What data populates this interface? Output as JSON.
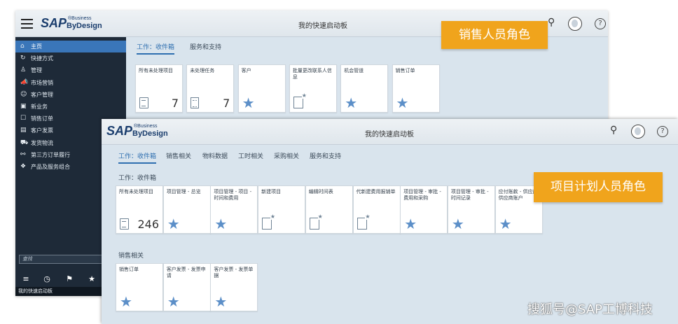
{
  "logo": {
    "sap": "SAP",
    "business": "®Business",
    "bydesign": "ByDesign"
  },
  "win1": {
    "title": "我的快速启动板",
    "tabs": [
      "工作：收件箱",
      "服务和支持"
    ],
    "nav": [
      {
        "icon": "⌂",
        "label": "主页"
      },
      {
        "icon": "↻",
        "label": "快捷方式"
      },
      {
        "icon": "♙",
        "label": "管理"
      },
      {
        "icon": "📣",
        "label": "市场营销"
      },
      {
        "icon": "☺",
        "label": "客户管理"
      },
      {
        "icon": "▣",
        "label": "新业务"
      },
      {
        "icon": "☐",
        "label": "销售订单"
      },
      {
        "icon": "▤",
        "label": "客户发票"
      },
      {
        "icon": "⛟",
        "label": "发货物流"
      },
      {
        "icon": "⚯",
        "label": "第三方订单履行"
      },
      {
        "icon": "❖",
        "label": "产品及服务组合"
      }
    ],
    "search_placeholder": "查找",
    "toolbar": [
      "≡",
      "◷",
      "⚑",
      "★"
    ],
    "status": "我的快速启动板",
    "tiles": [
      {
        "title": "所有未处理项目",
        "count": "7",
        "icon": "document-icon"
      },
      {
        "title": "未处理任务",
        "count": "7",
        "icon": "task-icon"
      },
      {
        "title": "客户",
        "icon": "star-icon"
      },
      {
        "title": "批量更改联系人信息",
        "icon": "new-document-icon"
      },
      {
        "title": "机会管道",
        "icon": "star-icon"
      },
      {
        "title": "销售订单",
        "icon": "star-icon"
      }
    ],
    "banner": "销售人员角色"
  },
  "win2": {
    "title": "我的快速启动板",
    "tabs": [
      "工作：收件箱",
      "销售相关",
      "物料数据",
      "工时相关",
      "采购相关",
      "服务和支持"
    ],
    "section1": "工作：收件箱",
    "tiles1": [
      {
        "title": "所有未处理项目",
        "count": "246",
        "icon": "document-icon"
      },
      {
        "title": "项目管理 - 总览",
        "icon": "star-icon"
      },
      {
        "title": "项目管理 - 项目 - 时间和费用",
        "icon": "star-icon"
      },
      {
        "title": "新建项目",
        "icon": "new-document-icon"
      },
      {
        "title": "编辑时间表",
        "icon": "new-document-icon"
      },
      {
        "title": "代新建费用报销单",
        "icon": "new-document-icon"
      },
      {
        "title": "项目管理 - 审批 - 费用和采购",
        "icon": "star-icon"
      },
      {
        "title": "项目管理 - 审批 - 时间记录",
        "icon": "star-icon"
      },
      {
        "title": "应付账款 - 供应商 - 供应商账户",
        "icon": "star-icon"
      }
    ],
    "section2": "销售相关",
    "tiles2": [
      {
        "title": "销售订单",
        "icon": "star-icon"
      },
      {
        "title": "客户发票 - 发票申请",
        "icon": "star-icon"
      },
      {
        "title": "客户发票 - 发票单据",
        "icon": "star-icon"
      }
    ],
    "banner": "项目计划人员角色"
  },
  "watermark": "搜狐号@SAP工博科技",
  "colors": {
    "accent": "#2f6fb0",
    "banner": "#f0a41c",
    "sidebar": "#1e2a38",
    "star": "#5c8fc8"
  }
}
